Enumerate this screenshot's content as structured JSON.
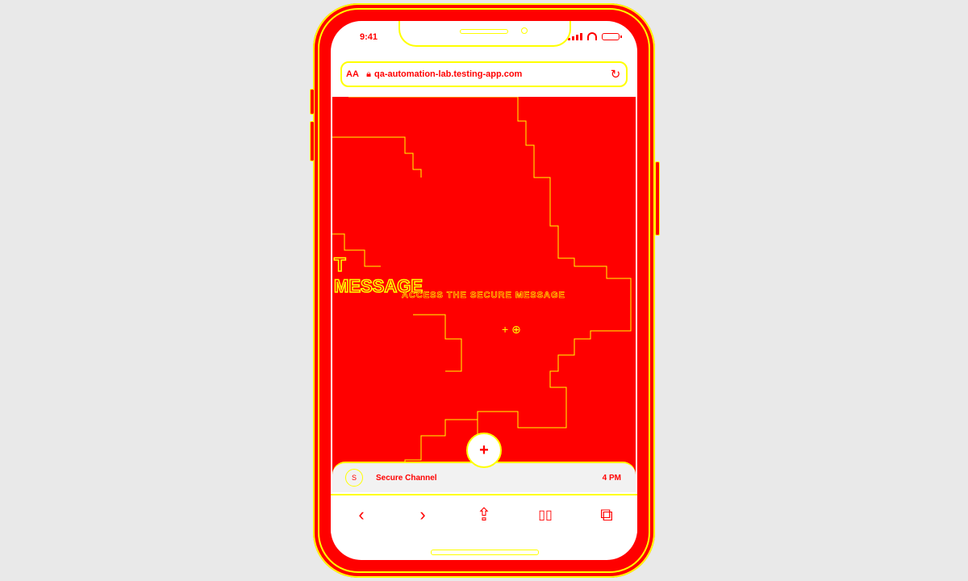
{
  "status_bar": {
    "time": "9:41"
  },
  "browser": {
    "text_size_label": "AA",
    "url": "qa-automation-lab.testing-app.com",
    "lock_icon": "lock-icon",
    "reload_icon": "reload-icon"
  },
  "hero": {
    "title_line1": "T",
    "title_line2": "MESSAGE",
    "subtitle": "ACCESS THE SECURE MESSAGE",
    "glyphs": "+ ⊕"
  },
  "fab": {
    "label": "+"
  },
  "mini_player": {
    "avatar": "S",
    "name": "Secure Channel",
    "count": "4 PM"
  },
  "toolbar": {
    "back": "‹",
    "forward": "›",
    "share": "⇪",
    "bookmarks": "▯▯",
    "tabs": "⧉"
  },
  "colors": {
    "accent": "#ff0000",
    "outline": "#ffff00",
    "background": "#e9e9e9"
  }
}
